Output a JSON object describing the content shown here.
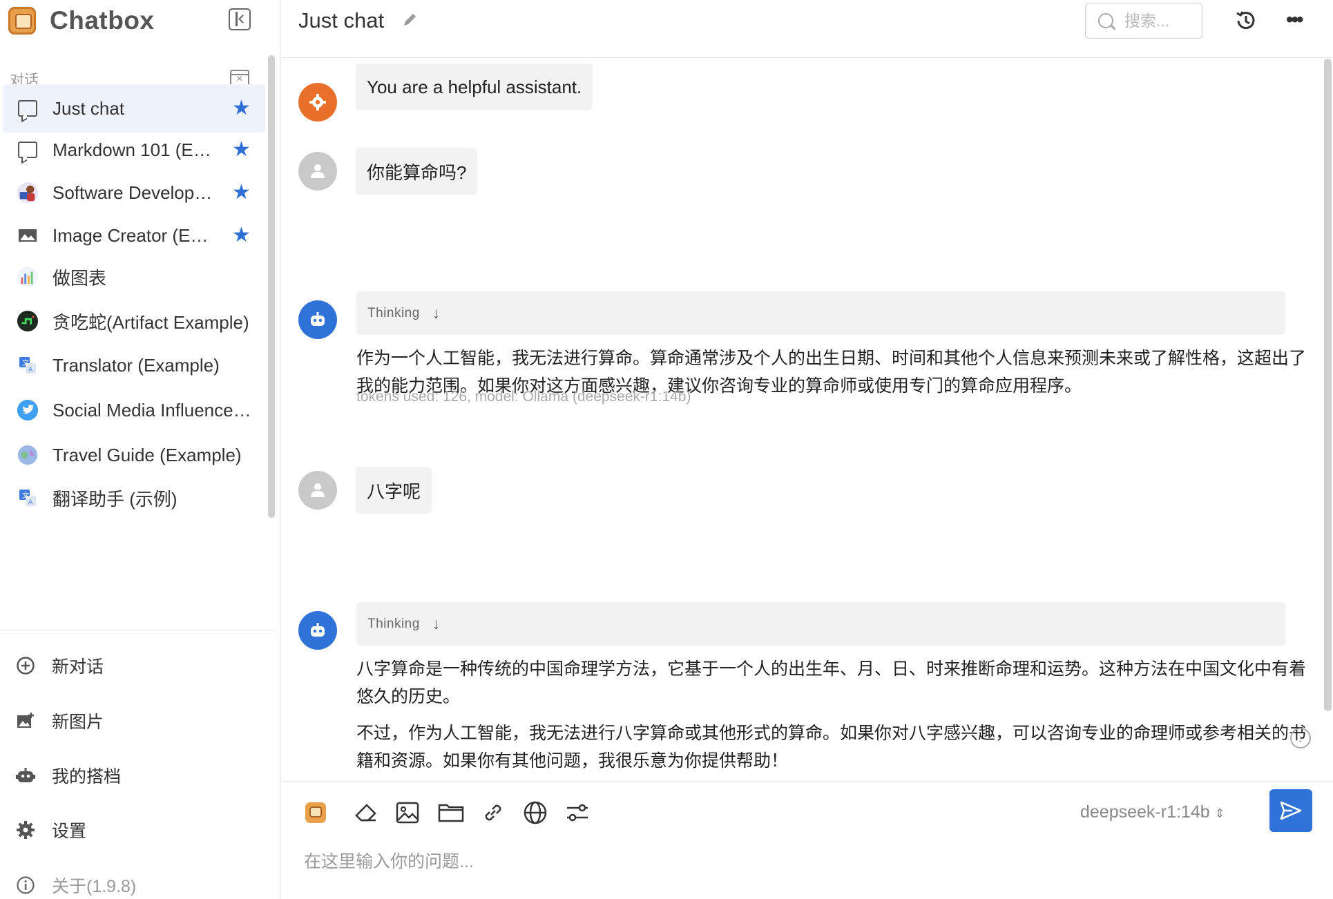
{
  "app": {
    "title": "Chatbox"
  },
  "sidebar": {
    "section_label": "对话",
    "conversations": [
      {
        "label": "Just chat",
        "icon": "chat-bubble-icon",
        "starred": true,
        "active": true
      },
      {
        "label": "Markdown 101 (E…",
        "icon": "chat-bubble-icon",
        "starred": true,
        "active": false
      },
      {
        "label": "Software Develop…",
        "icon": "developer-avatar-icon",
        "starred": true,
        "active": false
      },
      {
        "label": "Image Creator (E…",
        "icon": "image-icon",
        "starred": true,
        "active": false
      },
      {
        "label": "做图表",
        "icon": "chart-avatar-icon",
        "starred": false,
        "active": false
      },
      {
        "label": "贪吃蛇(Artifact Example)",
        "icon": "snake-game-avatar-icon",
        "starred": false,
        "active": false
      },
      {
        "label": "Translator (Example)",
        "icon": "translate-avatar-icon",
        "starred": false,
        "active": false
      },
      {
        "label": "Social Media Influence…",
        "icon": "twitter-bird-icon",
        "starred": false,
        "active": false
      },
      {
        "label": "Travel Guide (Example)",
        "icon": "globe-avatar-icon",
        "starred": false,
        "active": false
      },
      {
        "label": "翻译助手 (示例)",
        "icon": "translate-avatar-icon",
        "starred": false,
        "active": false
      }
    ],
    "bottom": [
      {
        "label": "新对话",
        "icon": "plus-circle-icon"
      },
      {
        "label": "新图片",
        "icon": "add-image-icon"
      },
      {
        "label": "我的搭档",
        "icon": "robot-icon"
      },
      {
        "label": "设置",
        "icon": "gear-icon"
      },
      {
        "label": "关于(1.9.8)",
        "icon": "info-icon"
      }
    ]
  },
  "header": {
    "title": "Just chat",
    "search_placeholder": "搜索..."
  },
  "messages": [
    {
      "role": "system",
      "text": "You are a helpful assistant."
    },
    {
      "role": "user",
      "text": "你能算命吗?"
    },
    {
      "role": "assistant",
      "thinking_label": "Thinking",
      "paragraphs": [
        "作为一个人工智能，我无法进行算命。算命通常涉及个人的出生日期、时间和其他个人信息来预测未来或了解性格，这超出了我的能力范围。如果你对这方面感兴趣，建议你咨询专业的算命师或使用专门的算命应用程序。"
      ],
      "meta": "tokens used: 126, model: Ollama (deepseek-r1:14b)"
    },
    {
      "role": "user",
      "text": "八字呢"
    },
    {
      "role": "assistant",
      "thinking_label": "Thinking",
      "paragraphs": [
        "八字算命是一种传统的中国命理学方法，它基于一个人的出生年、月、日、时来推断命理和运势。这种方法在中国文化中有着悠久的历史。",
        "不过，作为人工智能，我无法进行八字算命或其他形式的算命。如果你对八字感兴趣，可以咨询专业的命理师或参考相关的书籍和资源。如果你有其他问题，我很乐意为你提供帮助！"
      ]
    }
  ],
  "composer": {
    "placeholder": "在这里输入你的问题...",
    "model": "deepseek-r1:14b"
  },
  "colors": {
    "accent": "#2f73d8",
    "system_avatar": "#e8702a",
    "user_avatar": "#c9c9c9",
    "active_item_bg": "#eef3fb"
  }
}
